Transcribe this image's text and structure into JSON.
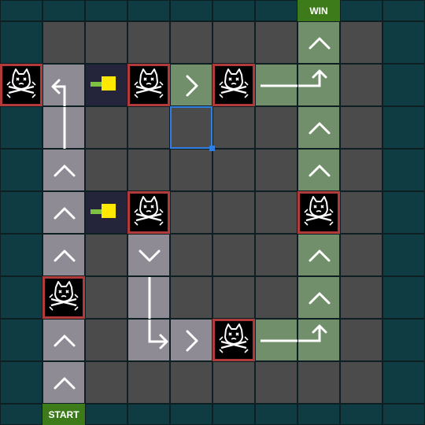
{
  "labels": {
    "win": "WIN",
    "start": "START"
  },
  "board": {
    "cols": 10,
    "rows": 10,
    "colors": {
      "edge": "#0f3b43",
      "floor": "#4b4b4b",
      "path_gray": "#8f8b95",
      "path_green": "#718f6b",
      "dark": "#24243a",
      "danger_border": "#b23a3a",
      "select": "#2f7ee3",
      "label_bg": "#3c7a1a",
      "cannon_body": "#ffe800",
      "cannon_barrel": "#7dc341"
    },
    "tiles": [
      {
        "r": 1,
        "c": 0,
        "type": "edge"
      },
      {
        "r": 1,
        "c": 1,
        "type": "floor"
      },
      {
        "r": 1,
        "c": 2,
        "type": "floor"
      },
      {
        "r": 1,
        "c": 3,
        "type": "floor"
      },
      {
        "r": 1,
        "c": 4,
        "type": "floor"
      },
      {
        "r": 1,
        "c": 5,
        "type": "floor"
      },
      {
        "r": 1,
        "c": 6,
        "type": "floor"
      },
      {
        "r": 1,
        "c": 7,
        "type": "path_green",
        "icon": "chevron-up-icon"
      },
      {
        "r": 1,
        "c": 8,
        "type": "floor"
      },
      {
        "r": 1,
        "c": 9,
        "type": "edge"
      },
      {
        "r": 2,
        "c": 0,
        "type": "edge"
      },
      {
        "r": 2,
        "c": 1,
        "type": "path_gray",
        "icon": "turn-up-left-icon"
      },
      {
        "r": 2,
        "c": 2,
        "type": "dark",
        "icon": "cannon-icon"
      },
      {
        "r": 2,
        "c": 3,
        "type": "floor"
      },
      {
        "r": 2,
        "c": 4,
        "type": "path_green",
        "icon": "chevron-right-icon"
      },
      {
        "r": 2,
        "c": 5,
        "type": "floor"
      },
      {
        "r": 2,
        "c": 6,
        "type": "path_green",
        "icon": "arrow-right-icon"
      },
      {
        "r": 2,
        "c": 7,
        "type": "path_green",
        "icon": "turn-right-up-icon"
      },
      {
        "r": 2,
        "c": 8,
        "type": "floor"
      },
      {
        "r": 2,
        "c": 9,
        "type": "edge"
      },
      {
        "r": 3,
        "c": 0,
        "type": "edge"
      },
      {
        "r": 3,
        "c": 1,
        "type": "path_gray",
        "icon": "line-vertical-icon"
      },
      {
        "r": 3,
        "c": 2,
        "type": "floor"
      },
      {
        "r": 3,
        "c": 3,
        "type": "floor"
      },
      {
        "r": 3,
        "c": 4,
        "type": "floor"
      },
      {
        "r": 3,
        "c": 5,
        "type": "floor"
      },
      {
        "r": 3,
        "c": 6,
        "type": "floor"
      },
      {
        "r": 3,
        "c": 7,
        "type": "path_green",
        "icon": "chevron-up-icon"
      },
      {
        "r": 3,
        "c": 8,
        "type": "floor"
      },
      {
        "r": 3,
        "c": 9,
        "type": "edge"
      },
      {
        "r": 4,
        "c": 0,
        "type": "edge"
      },
      {
        "r": 4,
        "c": 1,
        "type": "path_gray",
        "icon": "chevron-up-icon"
      },
      {
        "r": 4,
        "c": 2,
        "type": "floor"
      },
      {
        "r": 4,
        "c": 3,
        "type": "floor"
      },
      {
        "r": 4,
        "c": 4,
        "type": "floor"
      },
      {
        "r": 4,
        "c": 5,
        "type": "floor"
      },
      {
        "r": 4,
        "c": 6,
        "type": "floor"
      },
      {
        "r": 4,
        "c": 7,
        "type": "path_green",
        "icon": "chevron-up-icon"
      },
      {
        "r": 4,
        "c": 8,
        "type": "floor"
      },
      {
        "r": 4,
        "c": 9,
        "type": "edge"
      },
      {
        "r": 5,
        "c": 0,
        "type": "edge"
      },
      {
        "r": 5,
        "c": 1,
        "type": "path_gray",
        "icon": "chevron-up-icon"
      },
      {
        "r": 5,
        "c": 2,
        "type": "dark",
        "icon": "cannon-icon"
      },
      {
        "r": 5,
        "c": 3,
        "type": "floor"
      },
      {
        "r": 5,
        "c": 4,
        "type": "floor"
      },
      {
        "r": 5,
        "c": 5,
        "type": "floor"
      },
      {
        "r": 5,
        "c": 6,
        "type": "floor"
      },
      {
        "r": 5,
        "c": 7,
        "type": "floor"
      },
      {
        "r": 5,
        "c": 8,
        "type": "floor"
      },
      {
        "r": 5,
        "c": 9,
        "type": "edge"
      },
      {
        "r": 6,
        "c": 0,
        "type": "edge"
      },
      {
        "r": 6,
        "c": 1,
        "type": "path_gray",
        "icon": "chevron-up-icon"
      },
      {
        "r": 6,
        "c": 2,
        "type": "floor"
      },
      {
        "r": 6,
        "c": 3,
        "type": "path_gray",
        "icon": "chevron-down-icon"
      },
      {
        "r": 6,
        "c": 4,
        "type": "floor"
      },
      {
        "r": 6,
        "c": 5,
        "type": "floor"
      },
      {
        "r": 6,
        "c": 6,
        "type": "floor"
      },
      {
        "r": 6,
        "c": 7,
        "type": "path_green",
        "icon": "chevron-up-icon"
      },
      {
        "r": 6,
        "c": 8,
        "type": "floor"
      },
      {
        "r": 6,
        "c": 9,
        "type": "edge"
      },
      {
        "r": 7,
        "c": 0,
        "type": "edge"
      },
      {
        "r": 7,
        "c": 1,
        "type": "floor"
      },
      {
        "r": 7,
        "c": 2,
        "type": "floor"
      },
      {
        "r": 7,
        "c": 3,
        "type": "path_gray",
        "icon": "line-vertical-icon"
      },
      {
        "r": 7,
        "c": 4,
        "type": "floor"
      },
      {
        "r": 7,
        "c": 5,
        "type": "floor"
      },
      {
        "r": 7,
        "c": 6,
        "type": "floor"
      },
      {
        "r": 7,
        "c": 7,
        "type": "path_green",
        "icon": "chevron-up-icon"
      },
      {
        "r": 7,
        "c": 8,
        "type": "floor"
      },
      {
        "r": 7,
        "c": 9,
        "type": "edge"
      },
      {
        "r": 8,
        "c": 0,
        "type": "edge"
      },
      {
        "r": 8,
        "c": 1,
        "type": "path_gray",
        "icon": "chevron-up-icon"
      },
      {
        "r": 8,
        "c": 2,
        "type": "floor"
      },
      {
        "r": 8,
        "c": 3,
        "type": "path_gray",
        "icon": "turn-down-right-icon"
      },
      {
        "r": 8,
        "c": 4,
        "type": "path_gray",
        "icon": "chevron-right-icon"
      },
      {
        "r": 8,
        "c": 5,
        "type": "floor"
      },
      {
        "r": 8,
        "c": 6,
        "type": "path_green",
        "icon": "arrow-right-icon"
      },
      {
        "r": 8,
        "c": 7,
        "type": "path_green",
        "icon": "turn-right-up-icon"
      },
      {
        "r": 8,
        "c": 8,
        "type": "floor"
      },
      {
        "r": 8,
        "c": 9,
        "type": "edge"
      },
      {
        "r": 9,
        "c": 0,
        "type": "edge"
      },
      {
        "r": 9,
        "c": 1,
        "type": "path_gray",
        "icon": "chevron-up-icon"
      },
      {
        "r": 9,
        "c": 2,
        "type": "floor"
      },
      {
        "r": 9,
        "c": 3,
        "type": "floor"
      },
      {
        "r": 9,
        "c": 4,
        "type": "floor"
      },
      {
        "r": 9,
        "c": 5,
        "type": "floor"
      },
      {
        "r": 9,
        "c": 6,
        "type": "floor"
      },
      {
        "r": 9,
        "c": 7,
        "type": "floor"
      },
      {
        "r": 9,
        "c": 8,
        "type": "floor"
      },
      {
        "r": 9,
        "c": 9,
        "type": "edge"
      }
    ],
    "cats": [
      {
        "r": 2,
        "c": 0
      },
      {
        "r": 2,
        "c": 3
      },
      {
        "r": 2,
        "c": 5
      },
      {
        "r": 5,
        "c": 3
      },
      {
        "r": 5,
        "c": 7
      },
      {
        "r": 7,
        "c": 1
      },
      {
        "r": 8,
        "c": 5
      }
    ],
    "win": {
      "c": 7
    },
    "start": {
      "c": 1
    },
    "selected": {
      "r": 3,
      "c": 4
    }
  }
}
